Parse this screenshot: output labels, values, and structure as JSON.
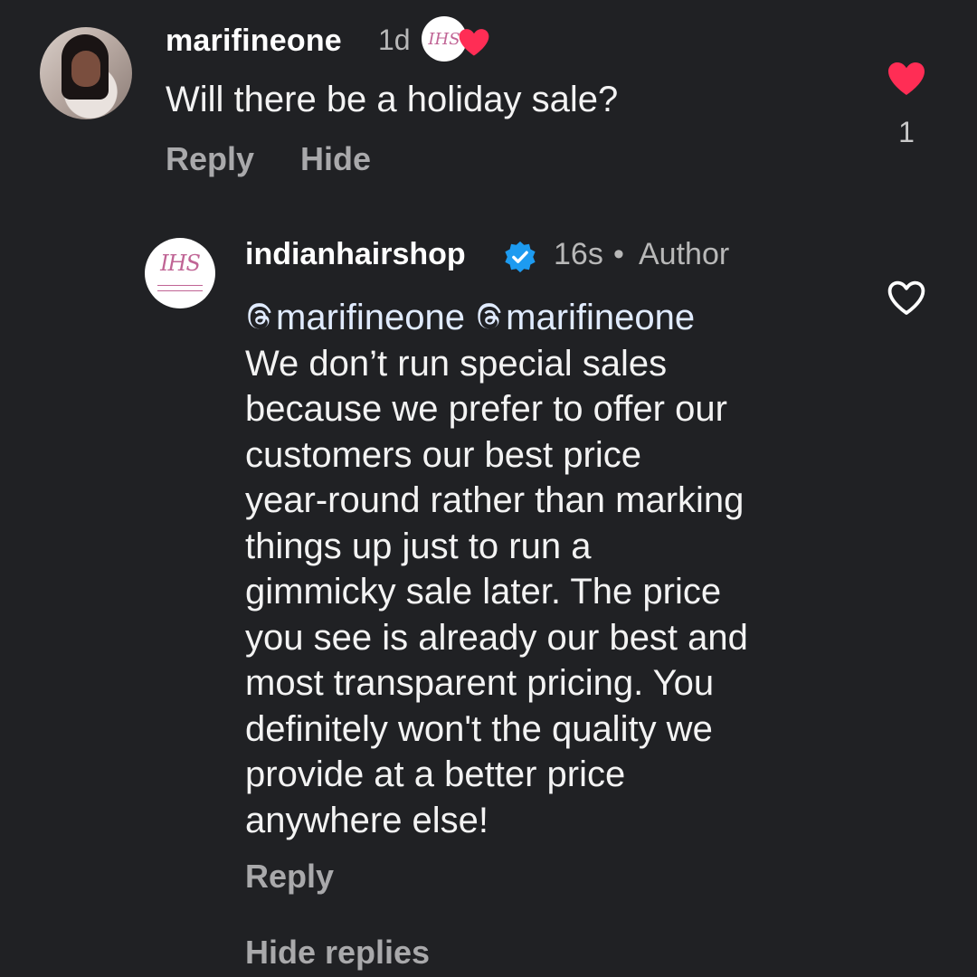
{
  "colors": {
    "background": "#202124",
    "like_red": "#ff2d55",
    "verified_blue": "#1d9bf0",
    "secondary_text": "#a9a9ab"
  },
  "comment": {
    "username": "marifineone",
    "time": "1d",
    "text": "Will there be a holiday sale?",
    "reply_label": "Reply",
    "hide_label": "Hide",
    "like_count": "1",
    "liked": true,
    "creator_liked_icon": "creator-heart-icon"
  },
  "reply": {
    "username": "indianhairshop",
    "verified": true,
    "time": "16s",
    "separator": "•",
    "role": "Author",
    "mentions": [
      "marifineone",
      "marifineone"
    ],
    "lines": [
      "We don’t run special sales",
      "because we prefer to offer our",
      "customers our best price",
      "year-round rather than marking",
      "things up just to run a",
      "gimmicky sale later. The price",
      "you see is already our best and",
      "most transparent pricing. You",
      "definitely won't the quality we",
      "provide at a better price",
      "anywhere else!"
    ],
    "reply_label": "Reply",
    "liked": false,
    "avatar_text": "IHS"
  },
  "hide_replies_label": "Hide replies"
}
